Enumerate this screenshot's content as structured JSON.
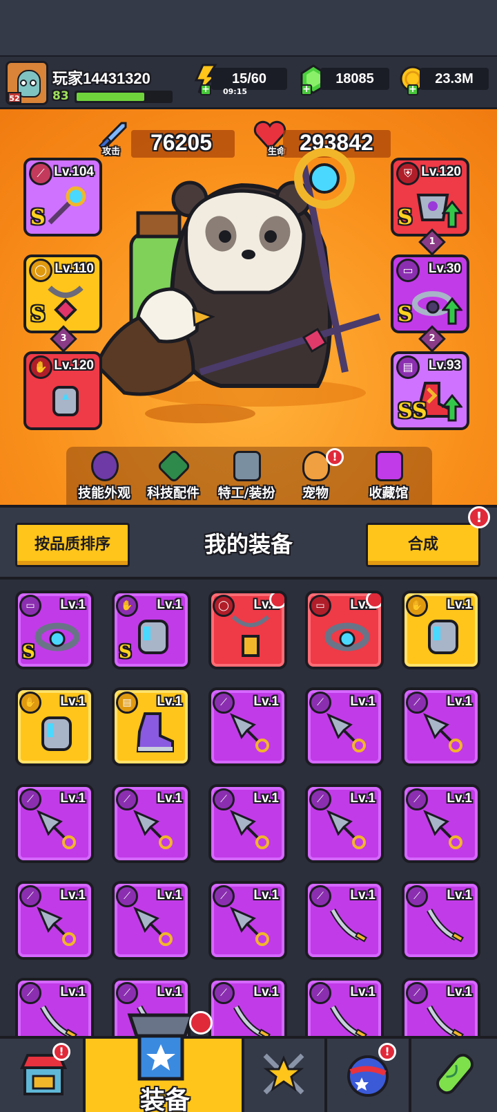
{
  "player": {
    "name": "玩家14431320",
    "level": "83",
    "rank": "52",
    "xp_fraction": 0.72
  },
  "resources": {
    "energy": {
      "value": "15/60",
      "timer": "09:15",
      "icon": "lightning-icon"
    },
    "gems": {
      "value": "18085",
      "icon": "green-gem-icon"
    },
    "coins": {
      "value": "23.3M",
      "icon": "gold-coin-icon"
    }
  },
  "stats": {
    "attack": {
      "value": "76205",
      "label": "攻击",
      "icon": "sword-icon"
    },
    "health": {
      "value": "293842",
      "label": "生命",
      "icon": "heart-icon"
    }
  },
  "equipped": {
    "left": [
      {
        "level": "Lv.104",
        "grade": "S",
        "tag_icon": "weapon-tag-icon",
        "color": "#cf72ff"
      },
      {
        "level": "Lv.110",
        "grade": "S",
        "tag_icon": "necklace-tag-icon",
        "color": "#ffc51a",
        "stars": "3"
      },
      {
        "level": "Lv.120",
        "grade": "",
        "tag_icon": "glove-tag-icon",
        "color": "#ef3a47"
      }
    ],
    "right": [
      {
        "level": "Lv.120",
        "grade": "S",
        "tag_icon": "armor-tag-icon",
        "color": "#ef3a47",
        "stars": "1",
        "upgrade": true
      },
      {
        "level": "Lv.30",
        "grade": "S",
        "tag_icon": "belt-tag-icon",
        "color": "#c23be8",
        "stars": "2",
        "upgrade": true
      },
      {
        "level": "Lv.93",
        "grade": "SS",
        "tag_icon": "boot-tag-icon",
        "color": "#cf72ff",
        "upgrade": true
      }
    ]
  },
  "tabs": [
    {
      "label": "技能外观",
      "icon": "skill-skin-icon",
      "color": "#6d3aa6"
    },
    {
      "label": "科技配件",
      "icon": "tech-part-icon",
      "color": "#2e8a4a"
    },
    {
      "label": "特工/装扮",
      "icon": "agent-icon",
      "color": "#7a8fa0"
    },
    {
      "label": "宠物",
      "icon": "pet-shiba-icon",
      "color": "#f0a040",
      "badge": "!"
    },
    {
      "label": "收藏馆",
      "icon": "collection-chest-icon",
      "color": "#c23be8"
    }
  ],
  "toolbar": {
    "sort_label": "按品质排序",
    "title": "我的装备",
    "merge_label": "合成",
    "merge_badge": "!"
  },
  "inventory": [
    {
      "level": "Lv.1",
      "rarity": "purple",
      "type": "belt",
      "grade": "S"
    },
    {
      "level": "Lv.1",
      "rarity": "purple",
      "type": "glove",
      "grade": "S"
    },
    {
      "level": "Lv.1",
      "rarity": "red",
      "type": "necklace",
      "grade": "",
      "crown": true
    },
    {
      "level": "Lv.1",
      "rarity": "red",
      "type": "belt",
      "grade": "",
      "crown": true
    },
    {
      "level": "Lv.1",
      "rarity": "gold",
      "type": "glove",
      "grade": ""
    },
    {
      "level": "Lv.1",
      "rarity": "gold",
      "type": "glove",
      "grade": ""
    },
    {
      "level": "Lv.1",
      "rarity": "gold",
      "type": "boot",
      "grade": ""
    },
    {
      "level": "Lv.1",
      "rarity": "purple",
      "type": "kunai",
      "grade": ""
    },
    {
      "level": "Lv.1",
      "rarity": "purple",
      "type": "kunai",
      "grade": ""
    },
    {
      "level": "Lv.1",
      "rarity": "purple",
      "type": "kunai",
      "grade": ""
    },
    {
      "level": "Lv.1",
      "rarity": "purple",
      "type": "kunai",
      "grade": ""
    },
    {
      "level": "Lv.1",
      "rarity": "purple",
      "type": "kunai",
      "grade": ""
    },
    {
      "level": "Lv.1",
      "rarity": "purple",
      "type": "kunai",
      "grade": ""
    },
    {
      "level": "Lv.1",
      "rarity": "purple",
      "type": "kunai",
      "grade": ""
    },
    {
      "level": "Lv.1",
      "rarity": "purple",
      "type": "kunai",
      "grade": ""
    },
    {
      "level": "Lv.1",
      "rarity": "purple",
      "type": "kunai",
      "grade": ""
    },
    {
      "level": "Lv.1",
      "rarity": "purple",
      "type": "kunai",
      "grade": ""
    },
    {
      "level": "Lv.1",
      "rarity": "purple",
      "type": "kunai",
      "grade": ""
    },
    {
      "level": "Lv.1",
      "rarity": "purple",
      "type": "katana",
      "grade": ""
    },
    {
      "level": "Lv.1",
      "rarity": "purple",
      "type": "katana",
      "grade": ""
    },
    {
      "level": "Lv.1",
      "rarity": "purple",
      "type": "katana",
      "grade": ""
    },
    {
      "level": "Lv.1",
      "rarity": "purple",
      "type": "katana",
      "grade": ""
    },
    {
      "level": "Lv.1",
      "rarity": "purple",
      "type": "katana",
      "grade": ""
    },
    {
      "level": "Lv.1",
      "rarity": "purple",
      "type": "katana",
      "grade": ""
    },
    {
      "level": "Lv.1",
      "rarity": "purple",
      "type": "katana",
      "grade": ""
    }
  ],
  "nav": [
    {
      "icon": "shop-icon",
      "badge": "!"
    },
    {
      "icon": "equipment-icon",
      "label": "装备",
      "active": true
    },
    {
      "icon": "star-battle-icon"
    },
    {
      "icon": "planet-icon",
      "badge": "!"
    },
    {
      "icon": "gene-capsule-icon"
    }
  ]
}
